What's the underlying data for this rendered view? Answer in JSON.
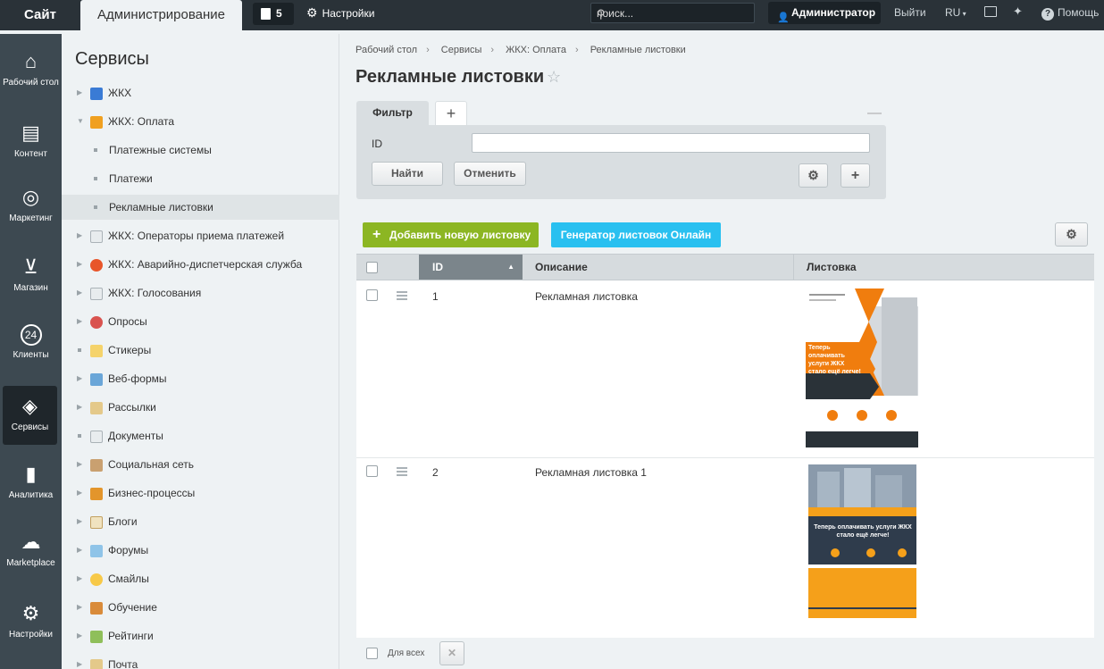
{
  "topbar": {
    "site": "Сайт",
    "admin": "Администрирование",
    "notifications": "5",
    "settings": "Настройки",
    "search_placeholder": "поиск...",
    "user": "Администратор",
    "logout": "Выйти",
    "lang": "RU",
    "help": "Помощь"
  },
  "leftnav": [
    {
      "label": "Рабочий стол",
      "icon": "home-icon"
    },
    {
      "label": "Контент",
      "icon": "document-icon"
    },
    {
      "label": "Маркетинг",
      "icon": "target-icon"
    },
    {
      "label": "Магазин",
      "icon": "basket-icon"
    },
    {
      "label": "Клиенты",
      "icon": "clients-24-icon"
    },
    {
      "label": "Сервисы",
      "icon": "layers-icon"
    },
    {
      "label": "Аналитика",
      "icon": "bar-chart-icon"
    },
    {
      "label": "Marketplace",
      "icon": "cloud-download-icon"
    },
    {
      "label": "Настройки",
      "icon": "gear-icon"
    }
  ],
  "sidebar": {
    "title": "Сервисы",
    "items": [
      {
        "label": "ЖКХ",
        "icon": "building-icon"
      },
      {
        "label": "ЖКХ: Оплата",
        "icon": "payment-icon"
      },
      {
        "label": "Платежные системы"
      },
      {
        "label": "Платежи"
      },
      {
        "label": "Рекламные листовки"
      },
      {
        "label": "ЖКХ: Операторы приема платежей",
        "icon": "page-icon"
      },
      {
        "label": "ЖКХ: Аварийно-диспетчерская служба",
        "icon": "lifebuoy-icon"
      },
      {
        "label": "ЖКХ: Голосования",
        "icon": "page-icon"
      },
      {
        "label": "Опросы",
        "icon": "pie-icon"
      },
      {
        "label": "Стикеры",
        "icon": "sticker-icon"
      },
      {
        "label": "Веб-формы",
        "icon": "form-icon"
      },
      {
        "label": "Рассылки",
        "icon": "mail-icon"
      },
      {
        "label": "Документы",
        "icon": "page-icon"
      },
      {
        "label": "Социальная сеть",
        "icon": "people-icon"
      },
      {
        "label": "Бизнес-процессы",
        "icon": "process-icon"
      },
      {
        "label": "Блоги",
        "icon": "blog-icon"
      },
      {
        "label": "Форумы",
        "icon": "forum-icon"
      },
      {
        "label": "Смайлы",
        "icon": "smile-icon"
      },
      {
        "label": "Обучение",
        "icon": "book-icon"
      },
      {
        "label": "Рейтинги",
        "icon": "rating-icon"
      },
      {
        "label": "Почта",
        "icon": "mail-icon"
      }
    ]
  },
  "breadcrumb": [
    "Рабочий стол",
    "Сервисы",
    "ЖКХ: Оплата",
    "Рекламные листовки"
  ],
  "page_title": "Рекламные листовки",
  "filter": {
    "tab": "Фильтр",
    "field_label": "ID",
    "field_value": "",
    "find": "Найти",
    "cancel": "Отменить"
  },
  "toolbar": {
    "add": "Добавить новую листовку",
    "generator": "Генератор листовок Онлайн"
  },
  "table": {
    "columns": [
      "ID",
      "Описание",
      "Листовка"
    ],
    "rows": [
      {
        "id": "1",
        "desc": "Рекламная листовка"
      },
      {
        "id": "2",
        "desc": "Рекламная листовка 1"
      }
    ],
    "footer_all": "Для всех"
  },
  "flyer1": {
    "headline": "Теперь оплачивать услуги ЖКХ стало ещё легче!",
    "accent": "#f07d0e"
  },
  "flyer2": {
    "headline": "Теперь оплачивать услуги ЖКХ стало ещё легче!",
    "accent": "#f5a01a"
  },
  "colors": {
    "green": "#8cb623",
    "blue": "#29c0f0",
    "dark": "#2a3238"
  }
}
